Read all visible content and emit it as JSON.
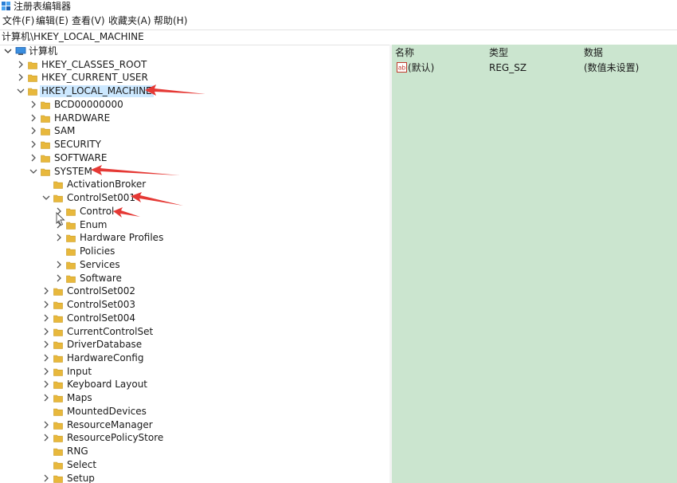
{
  "window": {
    "title": "注册表编辑器",
    "icon": "regedit-icon"
  },
  "menu": [
    "文件(F)",
    "编辑(E)",
    "查看(V)",
    "收藏夹(A)",
    "帮助(H)"
  ],
  "address": "计算机\\HKEY_LOCAL_MACHINE",
  "tree": {
    "root": "计算机",
    "nodes": [
      {
        "label": "HKEY_CLASSES_ROOT",
        "level": 1,
        "state": "collapsed"
      },
      {
        "label": "HKEY_CURRENT_USER",
        "level": 1,
        "state": "collapsed"
      },
      {
        "label": "HKEY_LOCAL_MACHINE",
        "level": 1,
        "state": "expanded",
        "selected": true
      },
      {
        "label": "BCD00000000",
        "level": 2,
        "state": "collapsed"
      },
      {
        "label": "HARDWARE",
        "level": 2,
        "state": "collapsed"
      },
      {
        "label": "SAM",
        "level": 2,
        "state": "collapsed"
      },
      {
        "label": "SECURITY",
        "level": 2,
        "state": "collapsed"
      },
      {
        "label": "SOFTWARE",
        "level": 2,
        "state": "collapsed"
      },
      {
        "label": "SYSTEM",
        "level": 2,
        "state": "expanded"
      },
      {
        "label": "ActivationBroker",
        "level": 3,
        "state": "none"
      },
      {
        "label": "ControlSet001",
        "level": 3,
        "state": "expanded"
      },
      {
        "label": "Control",
        "level": 4,
        "state": "collapsed"
      },
      {
        "label": "Enum",
        "level": 4,
        "state": "collapsed"
      },
      {
        "label": "Hardware Profiles",
        "level": 4,
        "state": "collapsed"
      },
      {
        "label": "Policies",
        "level": 4,
        "state": "none"
      },
      {
        "label": "Services",
        "level": 4,
        "state": "collapsed"
      },
      {
        "label": "Software",
        "level": 4,
        "state": "collapsed"
      },
      {
        "label": "ControlSet002",
        "level": 3,
        "state": "collapsed"
      },
      {
        "label": "ControlSet003",
        "level": 3,
        "state": "collapsed"
      },
      {
        "label": "ControlSet004",
        "level": 3,
        "state": "collapsed"
      },
      {
        "label": "CurrentControlSet",
        "level": 3,
        "state": "collapsed"
      },
      {
        "label": "DriverDatabase",
        "level": 3,
        "state": "collapsed"
      },
      {
        "label": "HardwareConfig",
        "level": 3,
        "state": "collapsed"
      },
      {
        "label": "Input",
        "level": 3,
        "state": "collapsed"
      },
      {
        "label": "Keyboard Layout",
        "level": 3,
        "state": "collapsed"
      },
      {
        "label": "Maps",
        "level": 3,
        "state": "collapsed"
      },
      {
        "label": "MountedDevices",
        "level": 3,
        "state": "none"
      },
      {
        "label": "ResourceManager",
        "level": 3,
        "state": "collapsed"
      },
      {
        "label": "ResourcePolicyStore",
        "level": 3,
        "state": "collapsed"
      },
      {
        "label": "RNG",
        "level": 3,
        "state": "none"
      },
      {
        "label": "Select",
        "level": 3,
        "state": "none"
      },
      {
        "label": "Setup",
        "level": 3,
        "state": "collapsed"
      }
    ]
  },
  "values": {
    "columns": [
      "名称",
      "类型",
      "数据"
    ],
    "rows": [
      {
        "name": "(默认)",
        "type": "REG_SZ",
        "data": "(数值未设置)",
        "icon": "ab-string-icon"
      }
    ]
  },
  "colors": {
    "values_bg": "#cbe5cf",
    "selection": "#cce8ff",
    "folder": "#e8b83c",
    "annotation_arrow": "#e53935"
  },
  "annotations": {
    "arrows_point_to": [
      "HKEY_LOCAL_MACHINE",
      "SYSTEM",
      "ControlSet001",
      "Control"
    ]
  }
}
